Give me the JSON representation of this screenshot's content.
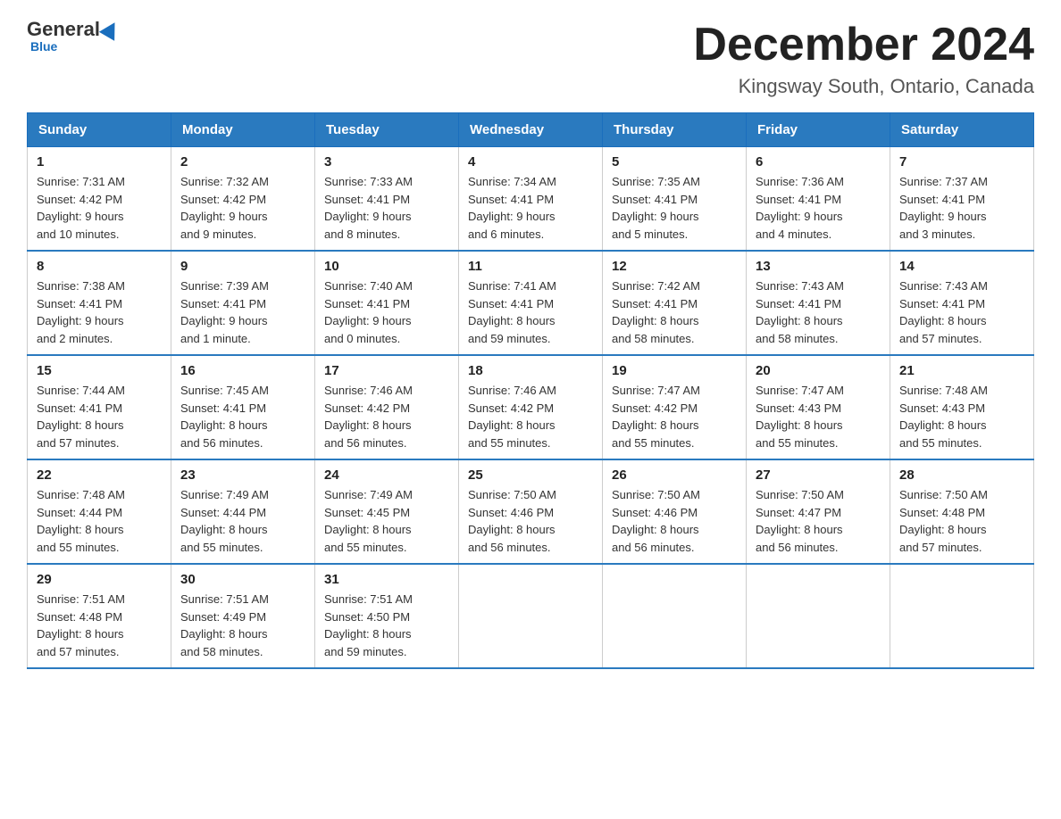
{
  "header": {
    "logo_general": "General",
    "logo_blue": "Blue",
    "main_title": "December 2024",
    "subtitle": "Kingsway South, Ontario, Canada"
  },
  "weekdays": [
    "Sunday",
    "Monday",
    "Tuesday",
    "Wednesday",
    "Thursday",
    "Friday",
    "Saturday"
  ],
  "weeks": [
    [
      {
        "day": "1",
        "info": "Sunrise: 7:31 AM\nSunset: 4:42 PM\nDaylight: 9 hours\nand 10 minutes."
      },
      {
        "day": "2",
        "info": "Sunrise: 7:32 AM\nSunset: 4:42 PM\nDaylight: 9 hours\nand 9 minutes."
      },
      {
        "day": "3",
        "info": "Sunrise: 7:33 AM\nSunset: 4:41 PM\nDaylight: 9 hours\nand 8 minutes."
      },
      {
        "day": "4",
        "info": "Sunrise: 7:34 AM\nSunset: 4:41 PM\nDaylight: 9 hours\nand 6 minutes."
      },
      {
        "day": "5",
        "info": "Sunrise: 7:35 AM\nSunset: 4:41 PM\nDaylight: 9 hours\nand 5 minutes."
      },
      {
        "day": "6",
        "info": "Sunrise: 7:36 AM\nSunset: 4:41 PM\nDaylight: 9 hours\nand 4 minutes."
      },
      {
        "day": "7",
        "info": "Sunrise: 7:37 AM\nSunset: 4:41 PM\nDaylight: 9 hours\nand 3 minutes."
      }
    ],
    [
      {
        "day": "8",
        "info": "Sunrise: 7:38 AM\nSunset: 4:41 PM\nDaylight: 9 hours\nand 2 minutes."
      },
      {
        "day": "9",
        "info": "Sunrise: 7:39 AM\nSunset: 4:41 PM\nDaylight: 9 hours\nand 1 minute."
      },
      {
        "day": "10",
        "info": "Sunrise: 7:40 AM\nSunset: 4:41 PM\nDaylight: 9 hours\nand 0 minutes."
      },
      {
        "day": "11",
        "info": "Sunrise: 7:41 AM\nSunset: 4:41 PM\nDaylight: 8 hours\nand 59 minutes."
      },
      {
        "day": "12",
        "info": "Sunrise: 7:42 AM\nSunset: 4:41 PM\nDaylight: 8 hours\nand 58 minutes."
      },
      {
        "day": "13",
        "info": "Sunrise: 7:43 AM\nSunset: 4:41 PM\nDaylight: 8 hours\nand 58 minutes."
      },
      {
        "day": "14",
        "info": "Sunrise: 7:43 AM\nSunset: 4:41 PM\nDaylight: 8 hours\nand 57 minutes."
      }
    ],
    [
      {
        "day": "15",
        "info": "Sunrise: 7:44 AM\nSunset: 4:41 PM\nDaylight: 8 hours\nand 57 minutes."
      },
      {
        "day": "16",
        "info": "Sunrise: 7:45 AM\nSunset: 4:41 PM\nDaylight: 8 hours\nand 56 minutes."
      },
      {
        "day": "17",
        "info": "Sunrise: 7:46 AM\nSunset: 4:42 PM\nDaylight: 8 hours\nand 56 minutes."
      },
      {
        "day": "18",
        "info": "Sunrise: 7:46 AM\nSunset: 4:42 PM\nDaylight: 8 hours\nand 55 minutes."
      },
      {
        "day": "19",
        "info": "Sunrise: 7:47 AM\nSunset: 4:42 PM\nDaylight: 8 hours\nand 55 minutes."
      },
      {
        "day": "20",
        "info": "Sunrise: 7:47 AM\nSunset: 4:43 PM\nDaylight: 8 hours\nand 55 minutes."
      },
      {
        "day": "21",
        "info": "Sunrise: 7:48 AM\nSunset: 4:43 PM\nDaylight: 8 hours\nand 55 minutes."
      }
    ],
    [
      {
        "day": "22",
        "info": "Sunrise: 7:48 AM\nSunset: 4:44 PM\nDaylight: 8 hours\nand 55 minutes."
      },
      {
        "day": "23",
        "info": "Sunrise: 7:49 AM\nSunset: 4:44 PM\nDaylight: 8 hours\nand 55 minutes."
      },
      {
        "day": "24",
        "info": "Sunrise: 7:49 AM\nSunset: 4:45 PM\nDaylight: 8 hours\nand 55 minutes."
      },
      {
        "day": "25",
        "info": "Sunrise: 7:50 AM\nSunset: 4:46 PM\nDaylight: 8 hours\nand 56 minutes."
      },
      {
        "day": "26",
        "info": "Sunrise: 7:50 AM\nSunset: 4:46 PM\nDaylight: 8 hours\nand 56 minutes."
      },
      {
        "day": "27",
        "info": "Sunrise: 7:50 AM\nSunset: 4:47 PM\nDaylight: 8 hours\nand 56 minutes."
      },
      {
        "day": "28",
        "info": "Sunrise: 7:50 AM\nSunset: 4:48 PM\nDaylight: 8 hours\nand 57 minutes."
      }
    ],
    [
      {
        "day": "29",
        "info": "Sunrise: 7:51 AM\nSunset: 4:48 PM\nDaylight: 8 hours\nand 57 minutes."
      },
      {
        "day": "30",
        "info": "Sunrise: 7:51 AM\nSunset: 4:49 PM\nDaylight: 8 hours\nand 58 minutes."
      },
      {
        "day": "31",
        "info": "Sunrise: 7:51 AM\nSunset: 4:50 PM\nDaylight: 8 hours\nand 59 minutes."
      },
      {
        "day": "",
        "info": ""
      },
      {
        "day": "",
        "info": ""
      },
      {
        "day": "",
        "info": ""
      },
      {
        "day": "",
        "info": ""
      }
    ]
  ]
}
